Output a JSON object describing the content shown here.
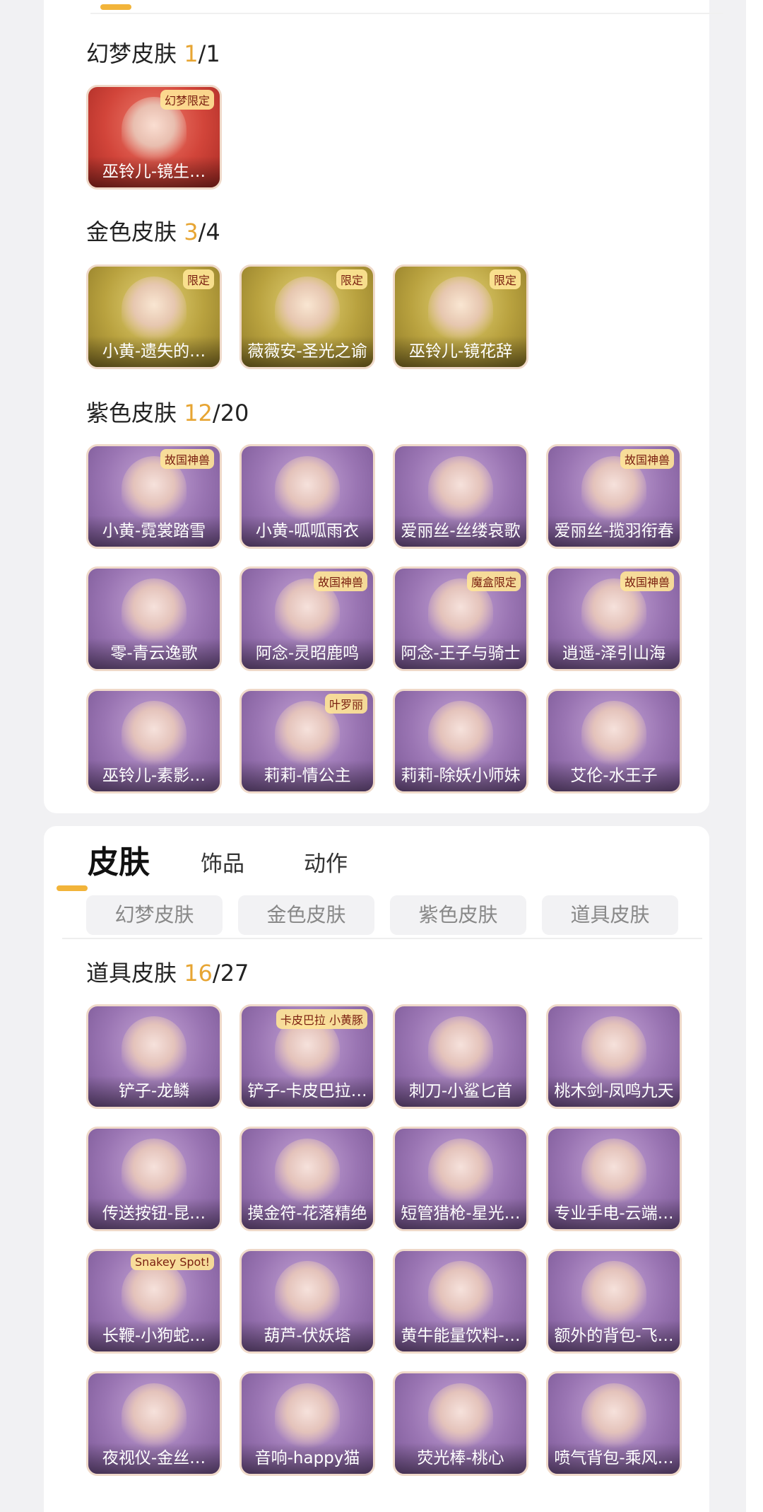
{
  "sections_top": [
    {
      "title": "幻梦皮肤",
      "owned": "1",
      "total": "/1",
      "items": [
        {
          "label": "巫铃儿-镜生…",
          "tone": "red",
          "tag": "幻梦限定"
        }
      ]
    },
    {
      "title": "金色皮肤",
      "owned": "3",
      "total": "/4",
      "items": [
        {
          "label": "小黄-遗失的…",
          "tone": "gold",
          "tag": "限定"
        },
        {
          "label": "薇薇安-圣光之谕",
          "tone": "gold",
          "tag": "限定"
        },
        {
          "label": "巫铃儿-镜花辞",
          "tone": "gold",
          "tag": "限定"
        }
      ]
    },
    {
      "title": "紫色皮肤",
      "owned": "12",
      "total": "/20",
      "items": [
        {
          "label": "小黄-霓裳踏雪",
          "tone": "purple",
          "tag": "故国神兽"
        },
        {
          "label": "小黄-呱呱雨衣",
          "tone": "purple",
          "tag": ""
        },
        {
          "label": "爱丽丝-丝缕哀歌",
          "tone": "purple",
          "tag": ""
        },
        {
          "label": "爱丽丝-揽羽衔春",
          "tone": "purple",
          "tag": "故国神兽"
        },
        {
          "label": "零-青云逸歌",
          "tone": "purple",
          "tag": ""
        },
        {
          "label": "阿念-灵昭鹿鸣",
          "tone": "purple",
          "tag": "故国神兽"
        },
        {
          "label": "阿念-王子与骑士",
          "tone": "purple",
          "tag": "魔盒限定"
        },
        {
          "label": "逍遥-泽引山海",
          "tone": "purple",
          "tag": "故国神兽"
        },
        {
          "label": "巫铃儿-素影…",
          "tone": "purple",
          "tag": ""
        },
        {
          "label": "莉莉-情公主",
          "tone": "purple",
          "tag": "叶罗丽"
        },
        {
          "label": "莉莉-除妖小师妹",
          "tone": "purple",
          "tag": ""
        },
        {
          "label": "艾伦-水王子",
          "tone": "purple",
          "tag": ""
        }
      ]
    }
  ],
  "tabs": {
    "active": "皮肤",
    "ornament": "饰品",
    "action": "动作"
  },
  "chips": [
    "幻梦皮肤",
    "金色皮肤",
    "紫色皮肤",
    "道具皮肤"
  ],
  "section_bottom": {
    "title": "道具皮肤",
    "owned": "16",
    "total": "/27",
    "items": [
      {
        "label": "铲子-龙鳞",
        "tone": "purple",
        "tag": ""
      },
      {
        "label": "铲子-卡皮巴拉…",
        "tone": "purple",
        "tag": "卡皮巴拉 小黄豚"
      },
      {
        "label": "刺刀-小鲨匕首",
        "tone": "purple",
        "tag": ""
      },
      {
        "label": "桃木剑-凤鸣九天",
        "tone": "purple",
        "tag": ""
      },
      {
        "label": "传送按钮-昆…",
        "tone": "purple",
        "tag": ""
      },
      {
        "label": "摸金符-花落精绝",
        "tone": "purple",
        "tag": ""
      },
      {
        "label": "短管猎枪-星光…",
        "tone": "purple",
        "tag": ""
      },
      {
        "label": "专业手电-云端…",
        "tone": "purple",
        "tag": ""
      },
      {
        "label": "长鞭-小狗蛇…",
        "tone": "purple",
        "tag": "Snakey Spot!"
      },
      {
        "label": "葫芦-伏妖塔",
        "tone": "purple",
        "tag": ""
      },
      {
        "label": "黄牛能量饮料-…",
        "tone": "purple",
        "tag": ""
      },
      {
        "label": "额外的背包-飞…",
        "tone": "purple",
        "tag": ""
      },
      {
        "label": "夜视仪-金丝…",
        "tone": "purple",
        "tag": ""
      },
      {
        "label": "音响-happy猫",
        "tone": "purple",
        "tag": ""
      },
      {
        "label": "荧光棒-桃心",
        "tone": "purple",
        "tag": ""
      },
      {
        "label": "喷气背包-乘风…",
        "tone": "purple",
        "tag": ""
      }
    ]
  }
}
